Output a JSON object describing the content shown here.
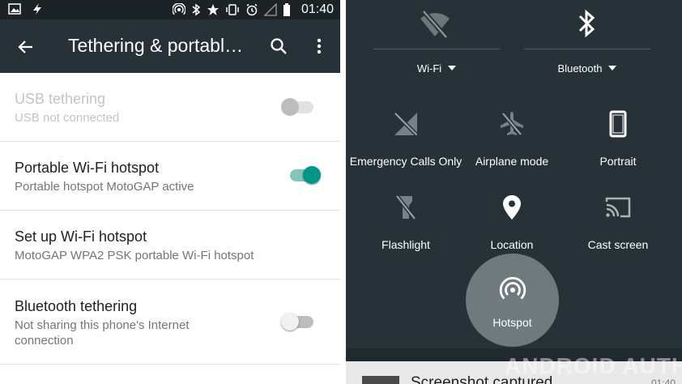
{
  "status_bar": {
    "time": "01:40"
  },
  "toolbar": {
    "title": "Tethering & portable hotspot"
  },
  "settings": [
    {
      "title": "USB tethering",
      "subtitle": "USB not connected",
      "switch": "off",
      "enabled": false
    },
    {
      "title": "Portable Wi-Fi hotspot",
      "subtitle": "Portable hotspot MotoGAP active",
      "switch": "on",
      "enabled": true
    },
    {
      "title": "Set up Wi-Fi hotspot",
      "subtitle": "MotoGAP WPA2 PSK portable Wi-Fi hotspot",
      "switch": "none",
      "enabled": true
    },
    {
      "title": "Bluetooth tethering",
      "subtitle": "Not sharing this phone's Internet connection",
      "switch": "off",
      "enabled": true
    }
  ],
  "quick_settings": {
    "wifi_label": "Wi-Fi",
    "bluetooth_label": "Bluetooth",
    "tiles": [
      {
        "label": "Emergency Calls Only",
        "icon": "no-signal-icon"
      },
      {
        "label": "Airplane mode",
        "icon": "airplane-off-icon"
      },
      {
        "label": "Portrait",
        "icon": "portrait-icon"
      },
      {
        "label": "Flashlight",
        "icon": "flashlight-off-icon"
      },
      {
        "label": "Location",
        "icon": "location-icon"
      },
      {
        "label": "Cast screen",
        "icon": "cast-icon"
      }
    ],
    "hotspot_label": "Hotspot"
  },
  "notification": {
    "title": "Screenshot captured",
    "time": "01:40"
  },
  "watermark": "ANDROID AUTHORITY",
  "colors": {
    "toolbar": "#263238",
    "accent": "#009688",
    "panel": "#263238"
  }
}
